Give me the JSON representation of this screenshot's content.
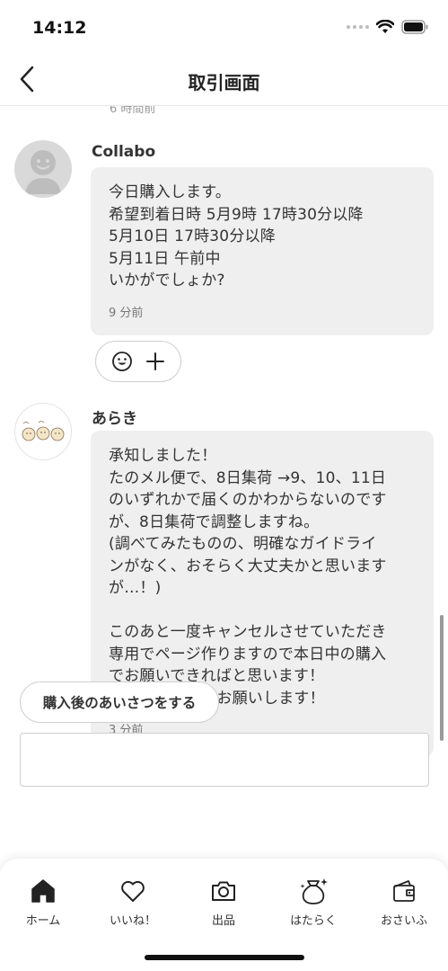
{
  "status_bar": {
    "time": "14:12"
  },
  "nav": {
    "title": "取引画面"
  },
  "chat": {
    "previous_time": "6 時間前",
    "messages": [
      {
        "sender": "Collabo",
        "text": "今日購入します。\n希望到着日時 5月9時 17時30分以降\n5月10日 17時30分以降\n5月11日 午前中\nいかがでしょか?",
        "time": "9 分前"
      },
      {
        "sender": "あらき",
        "text": "承知しました！\nたのメル便で、8日集荷 →9、10、11日\nのいずれかで届くのかわからないのです\nが、8日集荷で調整しますね。\n(調べてみたものの、明確なガイドライ\nンがなく、おそらく大丈夫かと思います\nが…！)\n\nこのあと一度キャンセルさせていただき\n専用でページ作りますので本日中の購入\nでお願いできればと思います！\nどうぞよろしくお願いします！",
        "time": "3 分前"
      }
    ]
  },
  "actions": {
    "greeting_button": "購入後のあいさつをする"
  },
  "tab_bar": {
    "items": [
      {
        "label": "ホーム",
        "icon": "home-icon"
      },
      {
        "label": "いいね！",
        "icon": "heart-icon"
      },
      {
        "label": "出品",
        "icon": "camera-icon"
      },
      {
        "label": "はたらく",
        "icon": "money-bag-icon"
      },
      {
        "label": "おさいふ",
        "icon": "wallet-icon"
      }
    ]
  }
}
